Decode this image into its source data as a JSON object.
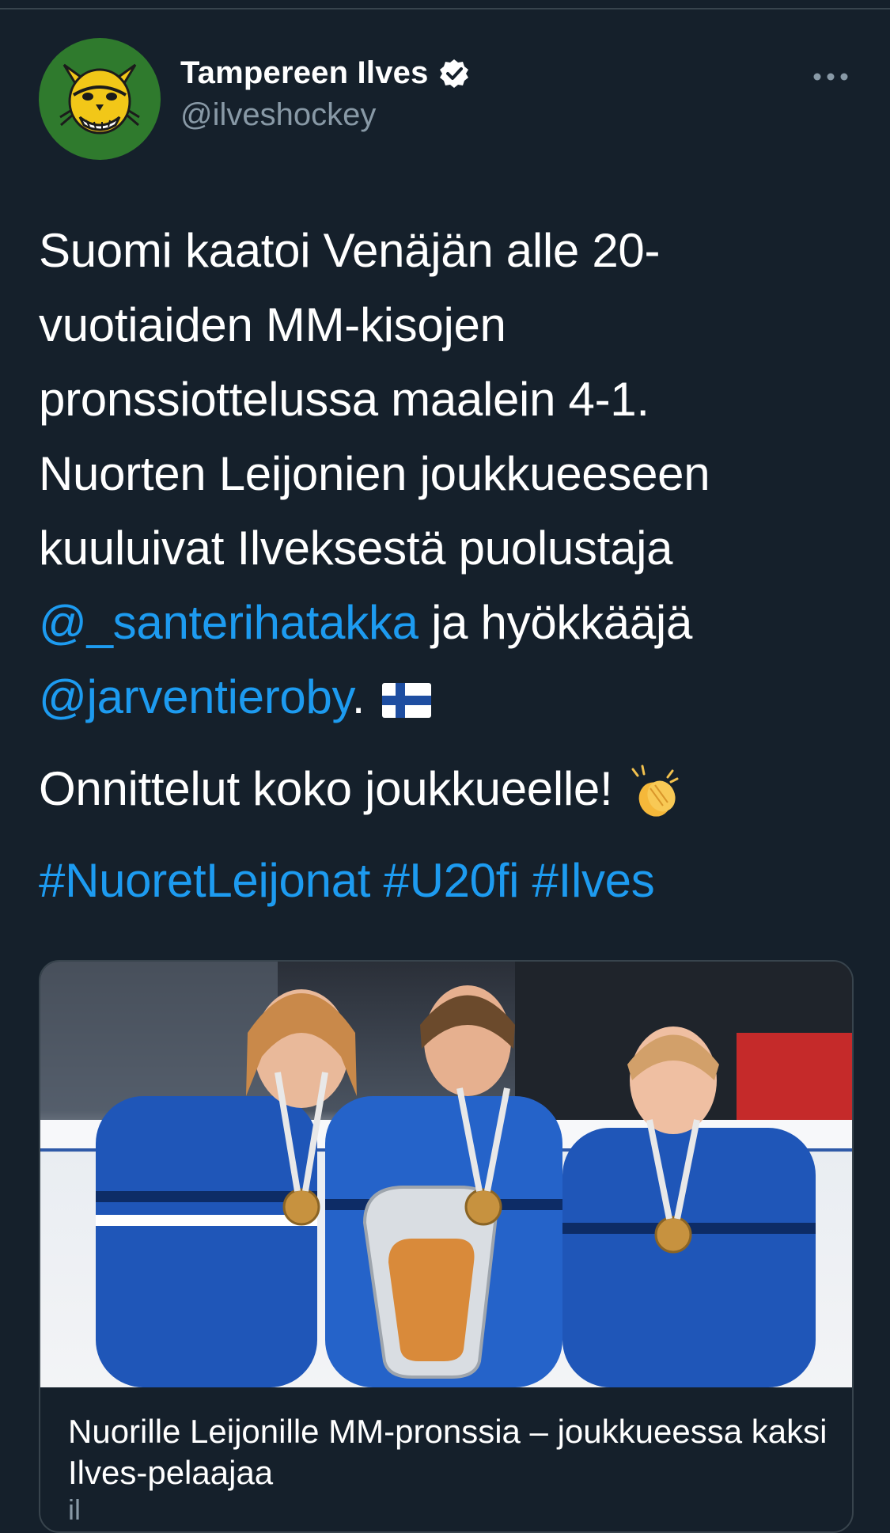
{
  "tweet": {
    "author": {
      "display_name": "Tampereen Ilves",
      "handle": "@ilveshockey",
      "verified": true,
      "avatar_icon": "lynx-logo-icon"
    },
    "text": {
      "line1": "Suomi kaatoi Venäjän alle 20-",
      "line2": "vuotiaiden MM-kisojen",
      "line3": "pronssiottelussa maalein 4-1.",
      "line4": "Nuorten Leijonien joukkueeseen",
      "line5": "kuuluivat Ilveksestä puolustaja",
      "mention1": "@_santerihatakka",
      "line6_rest": " ja hyökkääjä",
      "mention2": "@jarventieroby",
      "line7_rest": ".",
      "congrats": "Onnittelut koko joukkueelle!",
      "hashtags": "#NuoretLeijonat #U20fi #Ilves"
    },
    "emoji": {
      "flag": "finland-flag-icon",
      "clap": "clapping-hands-icon"
    },
    "card": {
      "title": "Nuorille Leijonille MM-pronssia – joukkueessa kaksi Ilves-pelaajaa",
      "domain": "il"
    }
  },
  "colors": {
    "background": "#15202b",
    "link": "#1d9bf0",
    "secondary_text": "#8899a6",
    "border": "#38444d"
  }
}
